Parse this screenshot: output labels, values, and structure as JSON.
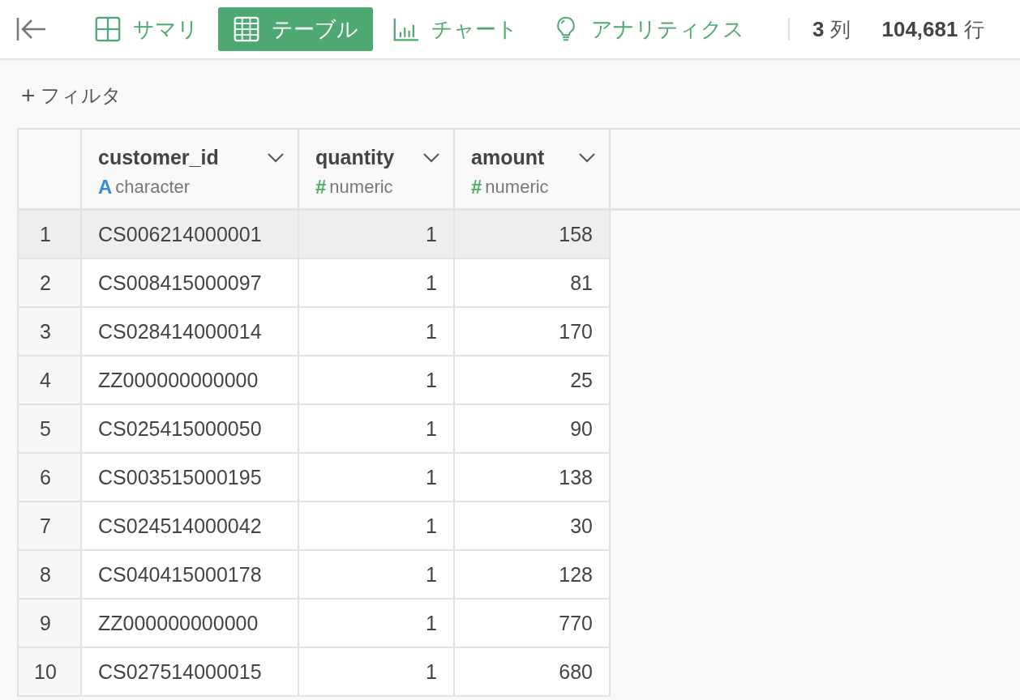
{
  "toolbar": {
    "tabs": [
      {
        "label": "サマリ",
        "kind": "summary",
        "selected": false
      },
      {
        "label": "テーブル",
        "kind": "table",
        "selected": true
      },
      {
        "label": "チャート",
        "kind": "chart",
        "selected": false
      },
      {
        "label": "アナリティクス",
        "kind": "analytics",
        "selected": false
      }
    ],
    "columns_count": "3",
    "columns_unit": "列",
    "rows_count": "104,681",
    "rows_unit": "行"
  },
  "filter": {
    "plus": "+",
    "label": "フィルタ"
  },
  "table": {
    "columns": [
      {
        "name": "customer_id",
        "type": "character",
        "type_mark": "A",
        "kind": "text"
      },
      {
        "name": "quantity",
        "type": "numeric",
        "type_mark": "#",
        "kind": "number"
      },
      {
        "name": "amount",
        "type": "numeric",
        "type_mark": "#",
        "kind": "number"
      }
    ],
    "rows": [
      {
        "index": "1",
        "cells": [
          "CS006214000001",
          "1",
          "158"
        ],
        "selected": true
      },
      {
        "index": "2",
        "cells": [
          "CS008415000097",
          "1",
          "81"
        ],
        "selected": false
      },
      {
        "index": "3",
        "cells": [
          "CS028414000014",
          "1",
          "170"
        ],
        "selected": false
      },
      {
        "index": "4",
        "cells": [
          "ZZ000000000000",
          "1",
          "25"
        ],
        "selected": false
      },
      {
        "index": "5",
        "cells": [
          "CS025415000050",
          "1",
          "90"
        ],
        "selected": false
      },
      {
        "index": "6",
        "cells": [
          "CS003515000195",
          "1",
          "138"
        ],
        "selected": false
      },
      {
        "index": "7",
        "cells": [
          "CS024514000042",
          "1",
          "30"
        ],
        "selected": false
      },
      {
        "index": "8",
        "cells": [
          "CS040415000178",
          "1",
          "128"
        ],
        "selected": false
      },
      {
        "index": "9",
        "cells": [
          "ZZ000000000000",
          "1",
          "770"
        ],
        "selected": false
      },
      {
        "index": "10",
        "cells": [
          "CS027514000015",
          "1",
          "680"
        ],
        "selected": false
      }
    ]
  }
}
